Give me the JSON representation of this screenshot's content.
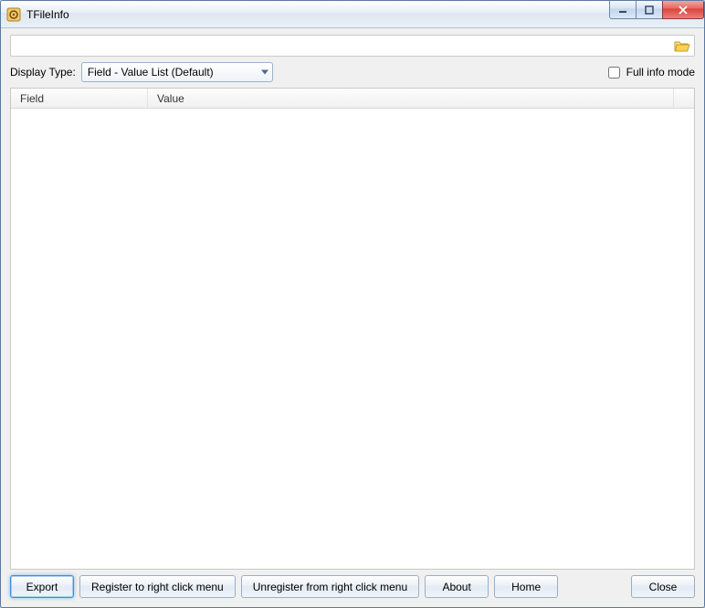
{
  "window": {
    "title": "TFileInfo"
  },
  "path": {
    "value": ""
  },
  "options": {
    "display_type_label": "Display Type:",
    "display_type_value": "Field - Value List (Default)",
    "full_info_label": "Full info mode",
    "full_info_checked": false
  },
  "table": {
    "columns": {
      "field": "Field",
      "value": "Value"
    },
    "rows": []
  },
  "buttons": {
    "export": "Export",
    "register": "Register to right click menu",
    "unregister": "Unregister from right click menu",
    "about": "About",
    "home": "Home",
    "close": "Close"
  }
}
